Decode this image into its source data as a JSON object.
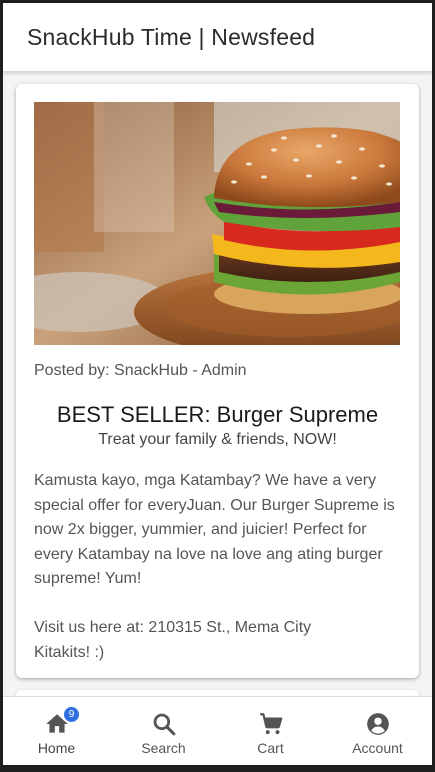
{
  "header": {
    "title": "SnackHub Time | Newsfeed"
  },
  "post": {
    "image_alt": "Burger Supreme photo",
    "posted_by": "Posted by: SnackHub - Admin",
    "title": "BEST SELLER: Burger Supreme",
    "subtitle": "Treat your family & friends, NOW!",
    "body": "Kamusta kayo, mga Katambay? We have a very special offer for everyJuan. Our Burger Supreme is now 2x bigger, yummier, and juicier! Perfect for every Katambay na love na love ang ating burger supreme! Yum!",
    "visit": "Visit us here at: 210315 St., Mema City",
    "signoff": "Kitakits! :)"
  },
  "tabs": [
    {
      "label": "Home",
      "icon": "home-icon",
      "badge": "9",
      "active": true
    },
    {
      "label": "Search",
      "icon": "search-icon"
    },
    {
      "label": "Cart",
      "icon": "cart-icon"
    },
    {
      "label": "Account",
      "icon": "account-icon"
    }
  ],
  "colors": {
    "badge": "#2f6fe0",
    "icon": "#555555",
    "header_bg": "#ffffff",
    "feed_bg": "#f4f4f4"
  }
}
